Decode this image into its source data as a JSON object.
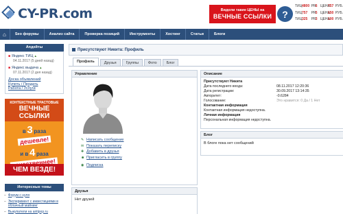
{
  "site": {
    "logo_text": "CY-PR.com"
  },
  "ad": {
    "line1": "Видели такие ЦЕНЫ на",
    "line2": "ВЕЧНЫЕ ССЫЛКИ",
    "badge": "?"
  },
  "prices": [
    {
      "k1": "ТИЦ",
      "v1": "4800",
      "k2": "PR",
      "v2": "6",
      "k3": "ЦЕНА",
      "v3": "757",
      "cur": "РУБ."
    },
    {
      "k1": "ТИЦ",
      "v1": "757",
      "k2": "PR",
      "v2": "5",
      "k3": "ЦЕНА",
      "v3": "150",
      "cur": "РУБ."
    },
    {
      "k1": "ТИЦ",
      "v1": "325",
      "k2": "PR",
      "v2": "3",
      "k3": "ЦЕНА",
      "v3": "100",
      "cur": "РУБ."
    }
  ],
  "nav": {
    "home_icon": "⌂",
    "items": [
      "Seo форумы",
      "Анализ сайта",
      "Проверка позиций",
      "Инструменты",
      "Хостинг",
      "Статьи",
      "Блоги"
    ]
  },
  "sidebar": {
    "activity_title": "Апдейты",
    "activity": [
      {
        "label": "Яндекс ТИЦ",
        "date": "04.11.2017 (5 дней назад)"
      },
      {
        "label": "Яндекс выдача",
        "date": "07.11.2017 (2 дня назад)"
      }
    ],
    "links": [
      "Доска объявлений",
      "Купить / Продать",
      "Работа / Услуги"
    ],
    "promo": {
      "small": "КОНТЕКСТНЫЕ ТРАСТОВЫЕ",
      "big": "ВЕЧНЫЕ ССЫЛКИ",
      "line1_word": "в",
      "line1_num": "3",
      "line1_tail": "раза",
      "tag1": "дешевле!",
      "line2_word": "и в",
      "line2_num": "4",
      "line2_tail": "раза",
      "tag2": "качественнее!",
      "bottom": "ЧЕМ ВЕЗДЕ!"
    },
    "topics_title": "Интересные темы",
    "topics": [
      "Форум с нуля",
      "Эксперимент с инвестициями в облачный майнинг",
      "Выкупатели на antipop.ru"
    ]
  },
  "main": {
    "breadcrumb": "Присутствуют Никита: Профиль",
    "tabs": [
      "Профиль",
      "Друзья",
      "Группы",
      "Фото",
      "Блог"
    ],
    "manage": {
      "title": "Управление",
      "actions": [
        "Написать сообщение",
        "Показать переписку",
        "Добавить в друзья",
        "Пригласить в группу"
      ],
      "subscribe": "Подписка"
    },
    "friends": {
      "title": "Друзья",
      "text": "Нет друзей"
    },
    "description": {
      "title": "Описание",
      "name": "Присутствуют Никита",
      "rows": [
        {
          "k": "Дата последнего входа:",
          "v": "08.11.2017 12:20:36"
        },
        {
          "k": "Дата регистрации:",
          "v": "30.09.2017 13:14:35"
        },
        {
          "k": "Авторитет:",
          "v": "-0.6284"
        },
        {
          "k": "Голосование:",
          "v": "Это нравится: 0 Да / 1 Нет"
        }
      ],
      "contact_title": "Контактная информация",
      "contact_text": "Контактная информация недоступна.",
      "personal_title": "Личная информация",
      "personal_text": "Персональная информация недоступна."
    },
    "blog": {
      "title": "Блог",
      "text": "В блоге пока нет сообщений"
    }
  }
}
